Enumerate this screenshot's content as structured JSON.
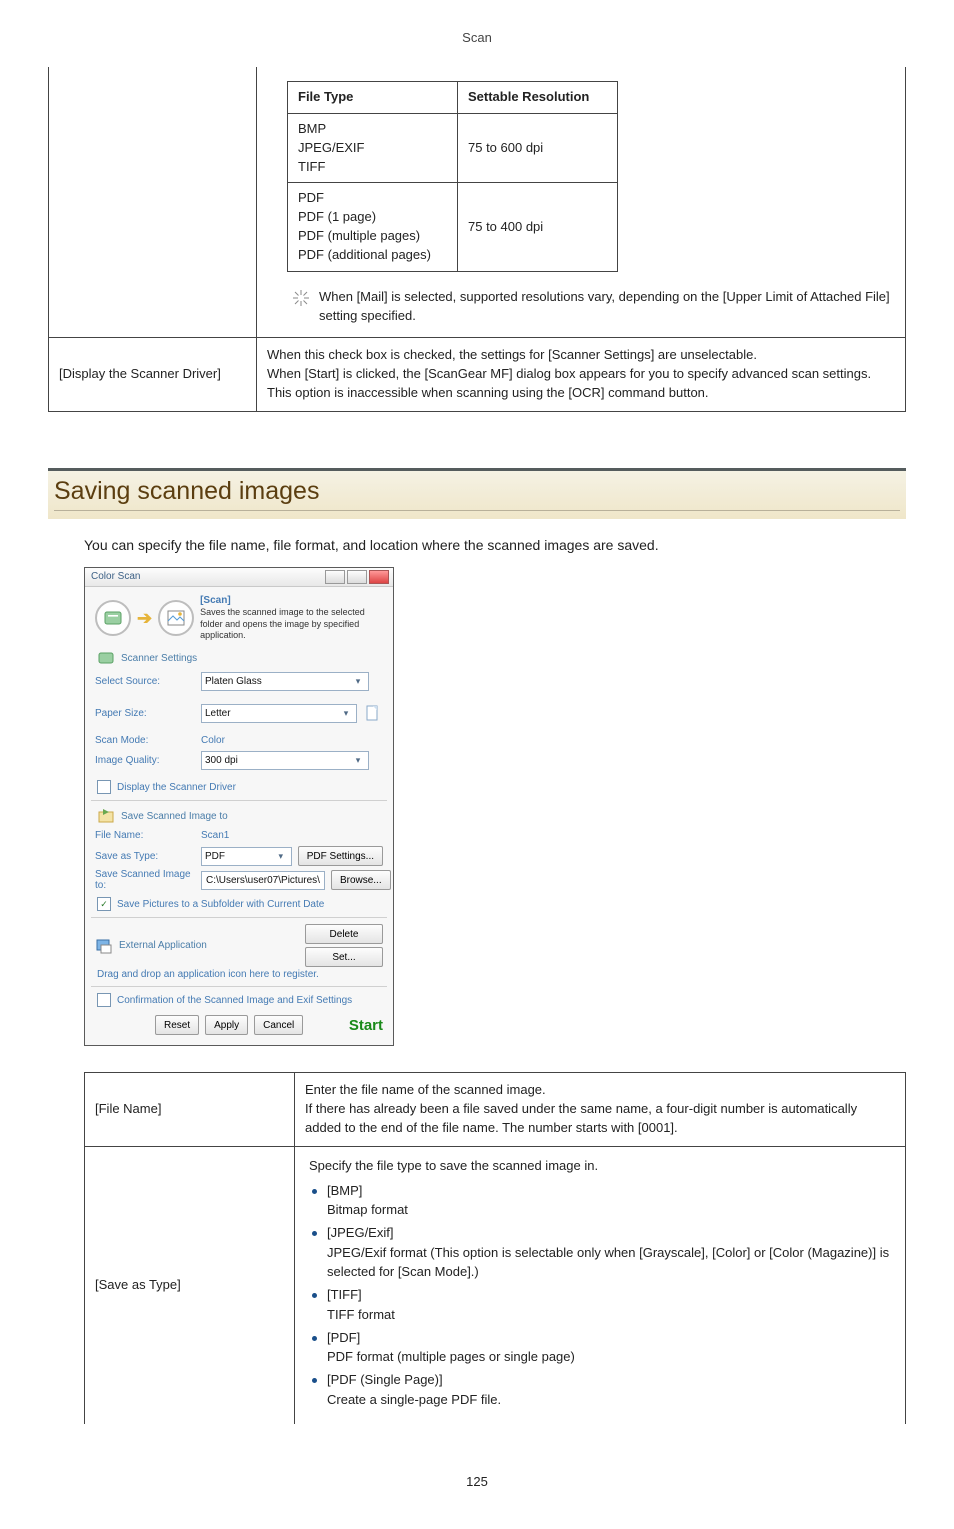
{
  "doc_header": "Scan",
  "upper_table": {
    "header": {
      "file_type": "File Type",
      "settable_res": "Settable Resolution"
    },
    "rows": [
      {
        "file_type_lines": [
          "BMP",
          "JPEG/EXIF",
          "TIFF"
        ],
        "res": "75 to 600 dpi"
      },
      {
        "file_type_lines": [
          "PDF",
          "PDF (1 page)",
          "PDF (multiple pages)",
          "PDF (additional pages)"
        ],
        "res": "75 to 400 dpi"
      }
    ],
    "note": "When [Mail] is selected, supported resolutions vary, depending on the [Upper Limit of Attached File] setting specified.",
    "row2_label": "[Display the Scanner Driver]",
    "row2_body_lines": [
      "When this check box is checked, the settings for [Scanner Settings] are unselectable.",
      "When [Start] is clicked, the [ScanGear MF] dialog box appears for you to specify advanced scan settings.",
      "This option is inaccessible when scanning using the [OCR] command button."
    ]
  },
  "heading": "Saving scanned images",
  "intro": "You can specify the file name, file format, and location where the scanned images are saved.",
  "shot": {
    "title": "Color Scan",
    "scan_title": "[Scan]",
    "scan_desc": "Saves the scanned image to the selected folder and opens the image by specified application.",
    "sec_scanner": "Scanner Settings",
    "select_source": {
      "label": "Select Source:",
      "value": "Platen Glass"
    },
    "paper_size": {
      "label": "Paper Size:",
      "value": "Letter"
    },
    "scan_mode": {
      "label": "Scan Mode:",
      "value": "Color"
    },
    "image_quality": {
      "label": "Image Quality:",
      "value": "300 dpi"
    },
    "display_driver": "Display the Scanner Driver",
    "sec_save": "Save Scanned Image to",
    "file_name": {
      "label": "File Name:",
      "value": "Scan1"
    },
    "save_as_type": {
      "label": "Save as Type:",
      "value": "PDF"
    },
    "pdf_settings": "PDF Settings...",
    "save_to": {
      "label": "Save Scanned Image to:",
      "value": "C:\\Users\\user07\\Pictures\\"
    },
    "browse": "Browse...",
    "save_subfolder": "Save Pictures to a Subfolder with Current Date",
    "sec_ext": "External Application",
    "drag_drop": "Drag and drop an application icon here to register.",
    "delete": "Delete",
    "set": "Set...",
    "confirm": "Confirmation of the Scanned Image and Exif Settings",
    "reset": "Reset",
    "apply": "Apply",
    "cancel": "Cancel",
    "start": "Start"
  },
  "lower_table": {
    "row1": {
      "label": "[File Name]",
      "body_lines": [
        "Enter the file name of the scanned image.",
        "If there has already been a file saved under the same name, a four-digit number is automatically added to the end of the file name. The number starts with [0001]."
      ]
    },
    "row2": {
      "label": "[Save as Type]",
      "intro": "Specify the file type to save the scanned image in.",
      "items": [
        {
          "head": "[BMP]",
          "sub": "Bitmap format"
        },
        {
          "head": "[JPEG/Exif]",
          "sub": "JPEG/Exif format (This option is selectable only when [Grayscale], [Color] or [Color (Magazine)] is selected for [Scan Mode].)"
        },
        {
          "head": "[TIFF]",
          "sub": "TIFF format"
        },
        {
          "head": "[PDF]",
          "sub": "PDF format (multiple pages or single page)"
        },
        {
          "head": "[PDF (Single Page)]",
          "sub": "Create a single-page PDF file."
        }
      ]
    }
  },
  "page_number": "125"
}
